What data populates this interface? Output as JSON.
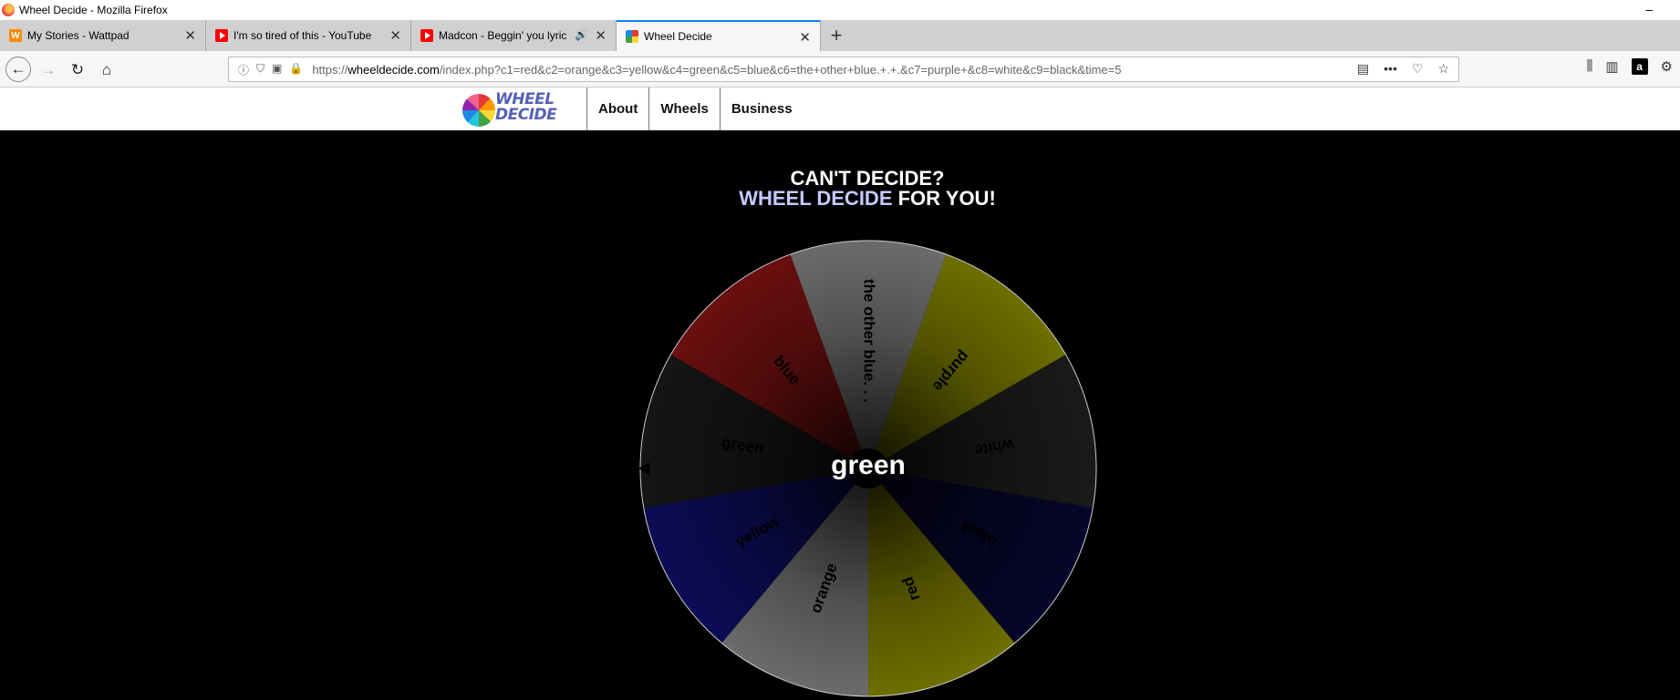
{
  "window": {
    "title": "Wheel Decide - Mozilla Firefox",
    "minimize": "–"
  },
  "tabs": [
    {
      "label": "My Stories - Wattpad",
      "close": "✕"
    },
    {
      "label": "I'm so tired of this - YouTube",
      "close": "✕"
    },
    {
      "label": "Madcon - Beggin' you lyric",
      "close": "✕",
      "speaker": "🔊"
    },
    {
      "label": "Wheel Decide",
      "close": "✕"
    }
  ],
  "newtab_label": "+",
  "address": {
    "url_prefix": "https://",
    "url_domain": "wheeldecide.com",
    "url_path": "/index.php?c1=red&c2=orange&c3=yellow&c4=green&c5=blue&c6=the+other+blue.+.+.&c7=purple+&c8=white&c9=black&time=5"
  },
  "site": {
    "logo_text_1": "WHEEL",
    "logo_text_2": "DECIDE",
    "menu": [
      "About",
      "Wheels",
      "Business"
    ]
  },
  "headline": {
    "line1": "CAN'T DECIDE?",
    "accent": "WHEEL DECIDE",
    "rest": " FOR YOU!"
  },
  "wheel": {
    "result": "green",
    "segments": [
      {
        "label": "white",
        "color": "#1a1a1a"
      },
      {
        "label": "black",
        "color": "#06062a"
      },
      {
        "label": "red",
        "color": "#6e6e00"
      },
      {
        "label": "orange",
        "color": "#6b6b6b"
      },
      {
        "label": "yellow",
        "color": "#0c0c55"
      },
      {
        "label": "green",
        "color": "#151515"
      },
      {
        "label": "blue",
        "color": "#6a0f0f"
      },
      {
        "label": "the other blue. . .",
        "color": "#6b6b6b"
      },
      {
        "label": "purple",
        "color": "#6e6e00"
      }
    ]
  }
}
